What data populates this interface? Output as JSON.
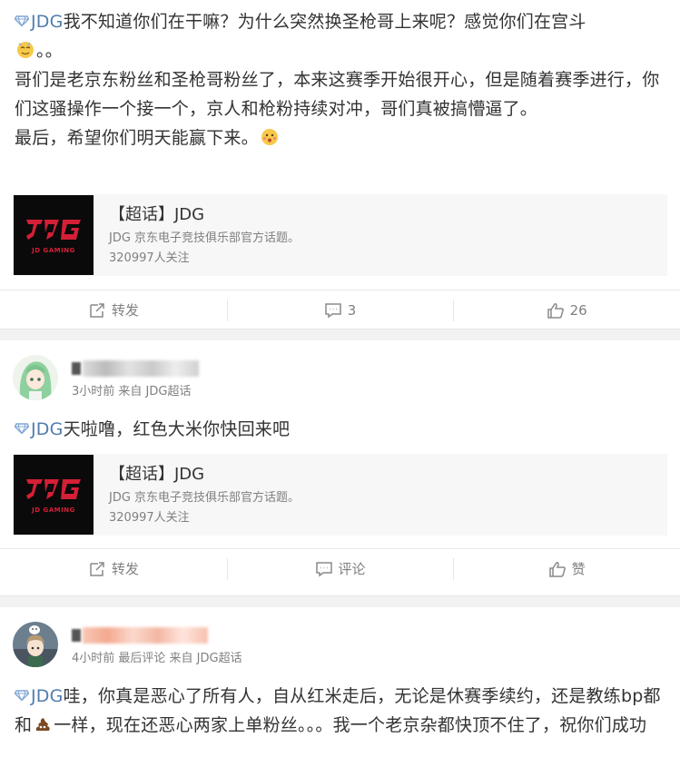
{
  "post1": {
    "topic_tag": "JDG",
    "line1": "我不知道你们在干嘛？为什么突然换圣枪哥上来呢？感觉你们在宫斗",
    "line1b": "。。",
    "para2": "哥们是老京东粉丝和圣枪哥粉丝了，本来这赛季开始很开心，但是随着赛季进行，你们这骚操作一个接一个，京人和枪粉持续对冲，哥们真被搞懵逼了。",
    "para3": "最后，希望你们明天能赢下来。",
    "topic_card": {
      "title": "【超话】JDG",
      "desc": "JDG 京东电子竞技俱乐部官方话题。",
      "followers": "320997人关注",
      "logo_text": "JD GAMING"
    },
    "actions": {
      "repost": "转发",
      "comment": "3",
      "like": "26"
    }
  },
  "post2": {
    "username": "",
    "meta": "3小时前 来自 JDG超话",
    "topic_tag": "JDG",
    "text": "天啦噜，红色大米你快回来吧",
    "topic_card": {
      "title": "【超话】JDG",
      "desc": "JDG 京东电子竞技俱乐部官方话题。",
      "followers": "320997人关注",
      "logo_text": "JD GAMING"
    },
    "actions": {
      "repost": "转发",
      "comment": "评论",
      "like": "赞"
    }
  },
  "post3": {
    "username": "",
    "meta": "4小时前 最后评论 来自 JDG超话",
    "topic_tag": "JDG",
    "text_a": "哇，你真是恶心了所有人，自从红米走后，无论是休赛季续约，还是教练bp都和",
    "text_b": "一样，现在还恶心两家上单粉丝。。。我一个老京杂都快顶不住了，祝你们成功"
  },
  "colors": {
    "link": "#507daf",
    "text": "#333333",
    "muted": "#808080",
    "jdg_red": "#d41f36"
  }
}
